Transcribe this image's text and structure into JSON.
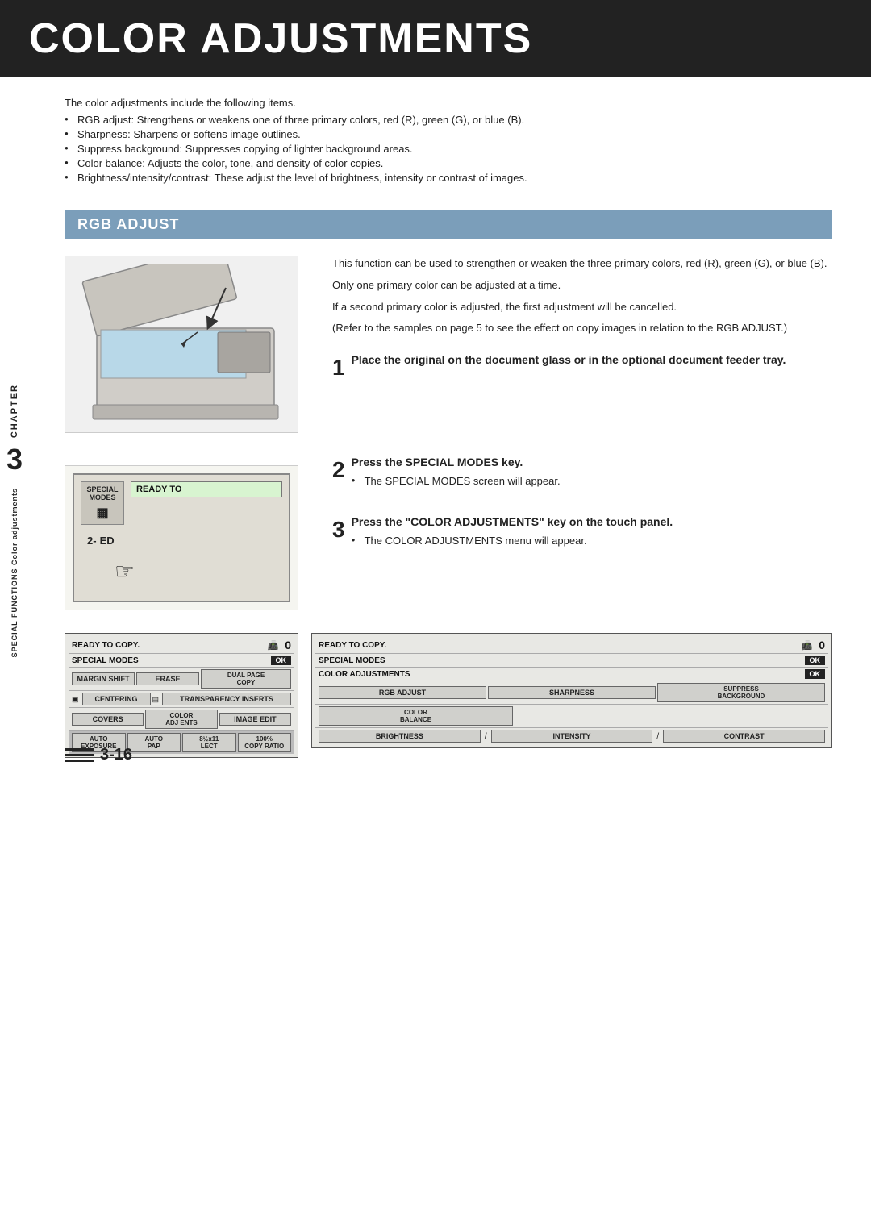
{
  "title": "COLOR ADJUSTMENTS",
  "intro": {
    "lead": "The color adjustments include the following items.",
    "bullets": [
      "RGB adjust: Strengthens or weakens one of three primary colors, red (R), green (G), or blue (B).",
      "Sharpness: Sharpens or softens image outlines.",
      "Suppress background: Suppresses copying of lighter background areas.",
      "Color balance: Adjusts the color, tone, and density of color copies.",
      "Brightness/intensity/contrast: These adjust the level of brightness, intensity or contrast of images."
    ]
  },
  "section": {
    "title": "RGB ADJUST"
  },
  "chapter": {
    "label": "CHAPTER",
    "number": "3",
    "sub": "SPECIAL FUNCTIONS Color adjustments"
  },
  "description": {
    "lines": [
      "This function can be used to strengthen or weaken the three primary colors, red (R), green (G), or blue (B).",
      "Only one primary color can be adjusted at a time.",
      "If a second primary color is adjusted, the first adjustment will be cancelled.",
      "(Refer to the samples on page 5 to see the effect on copy images in relation to the RGB ADJUST.)"
    ]
  },
  "steps": [
    {
      "number": "1",
      "title": "Place the original on the document glass or in the optional document feeder tray."
    },
    {
      "number": "2",
      "title": "Press the SPECIAL MODES key.",
      "bullet": "The SPECIAL MODES screen will appear."
    },
    {
      "number": "3",
      "title": "Press the \"COLOR ADJUSTMENTS\" key on the touch panel.",
      "bullet": "The COLOR ADJUSTMENTS menu will appear."
    }
  ],
  "special_panel": {
    "key_line1": "SPECIAL",
    "key_line2": "MODES",
    "display": "READY TO",
    "display_sub": "SPECIAL MODES",
    "dial_left": "2-",
    "dial_right": "ED"
  },
  "screen_left": {
    "row1_label": "READY TO COPY.",
    "row1_icon": "📠",
    "row1_num": "0",
    "row2_label": "SPECIAL MODES",
    "row2_ok": "OK",
    "row3_btn1": "MARGIN SHIFT",
    "row3_btn2": "ERASE",
    "row3_btn3": "DUAL PAGE\nCOPY",
    "row4_btn1": "CENTERING",
    "row4_btn2": "TRANSPARENCY INSERTS",
    "row5_btn1": "COVERS",
    "row5_btn2": "COLOR\nADJ ENTS",
    "row5_btn3": "IMAGE EDIT",
    "row6_btn1": "AUTO\nEXPOSURE",
    "row6_btn2": "AUTO\nPAP",
    "row6_btn3": "8½x11\nLECT",
    "row6_btn4": "100%\nCOPY RATIO"
  },
  "screen_right": {
    "row1_label": "READY TO COPY.",
    "row1_icon": "📠",
    "row1_num": "0",
    "row2_label": "SPECIAL MODES",
    "row2_ok": "OK",
    "row3_label": "COLOR ADJUSTMENTS",
    "row3_ok": "OK",
    "row4_btn1": "RGB ADJUST",
    "row4_btn2": "SHARPNESS",
    "row4_btn3": "SUPPRESS\nBACKGROUND",
    "row5_btn1": "COLOR\nBALANCE",
    "row6_btn1": "BRIGHTNESS",
    "row6_sep1": "/",
    "row6_btn2": "INTENSITY",
    "row6_sep2": "/",
    "row6_btn3": "CONTRAST"
  },
  "page_number": "3-16"
}
